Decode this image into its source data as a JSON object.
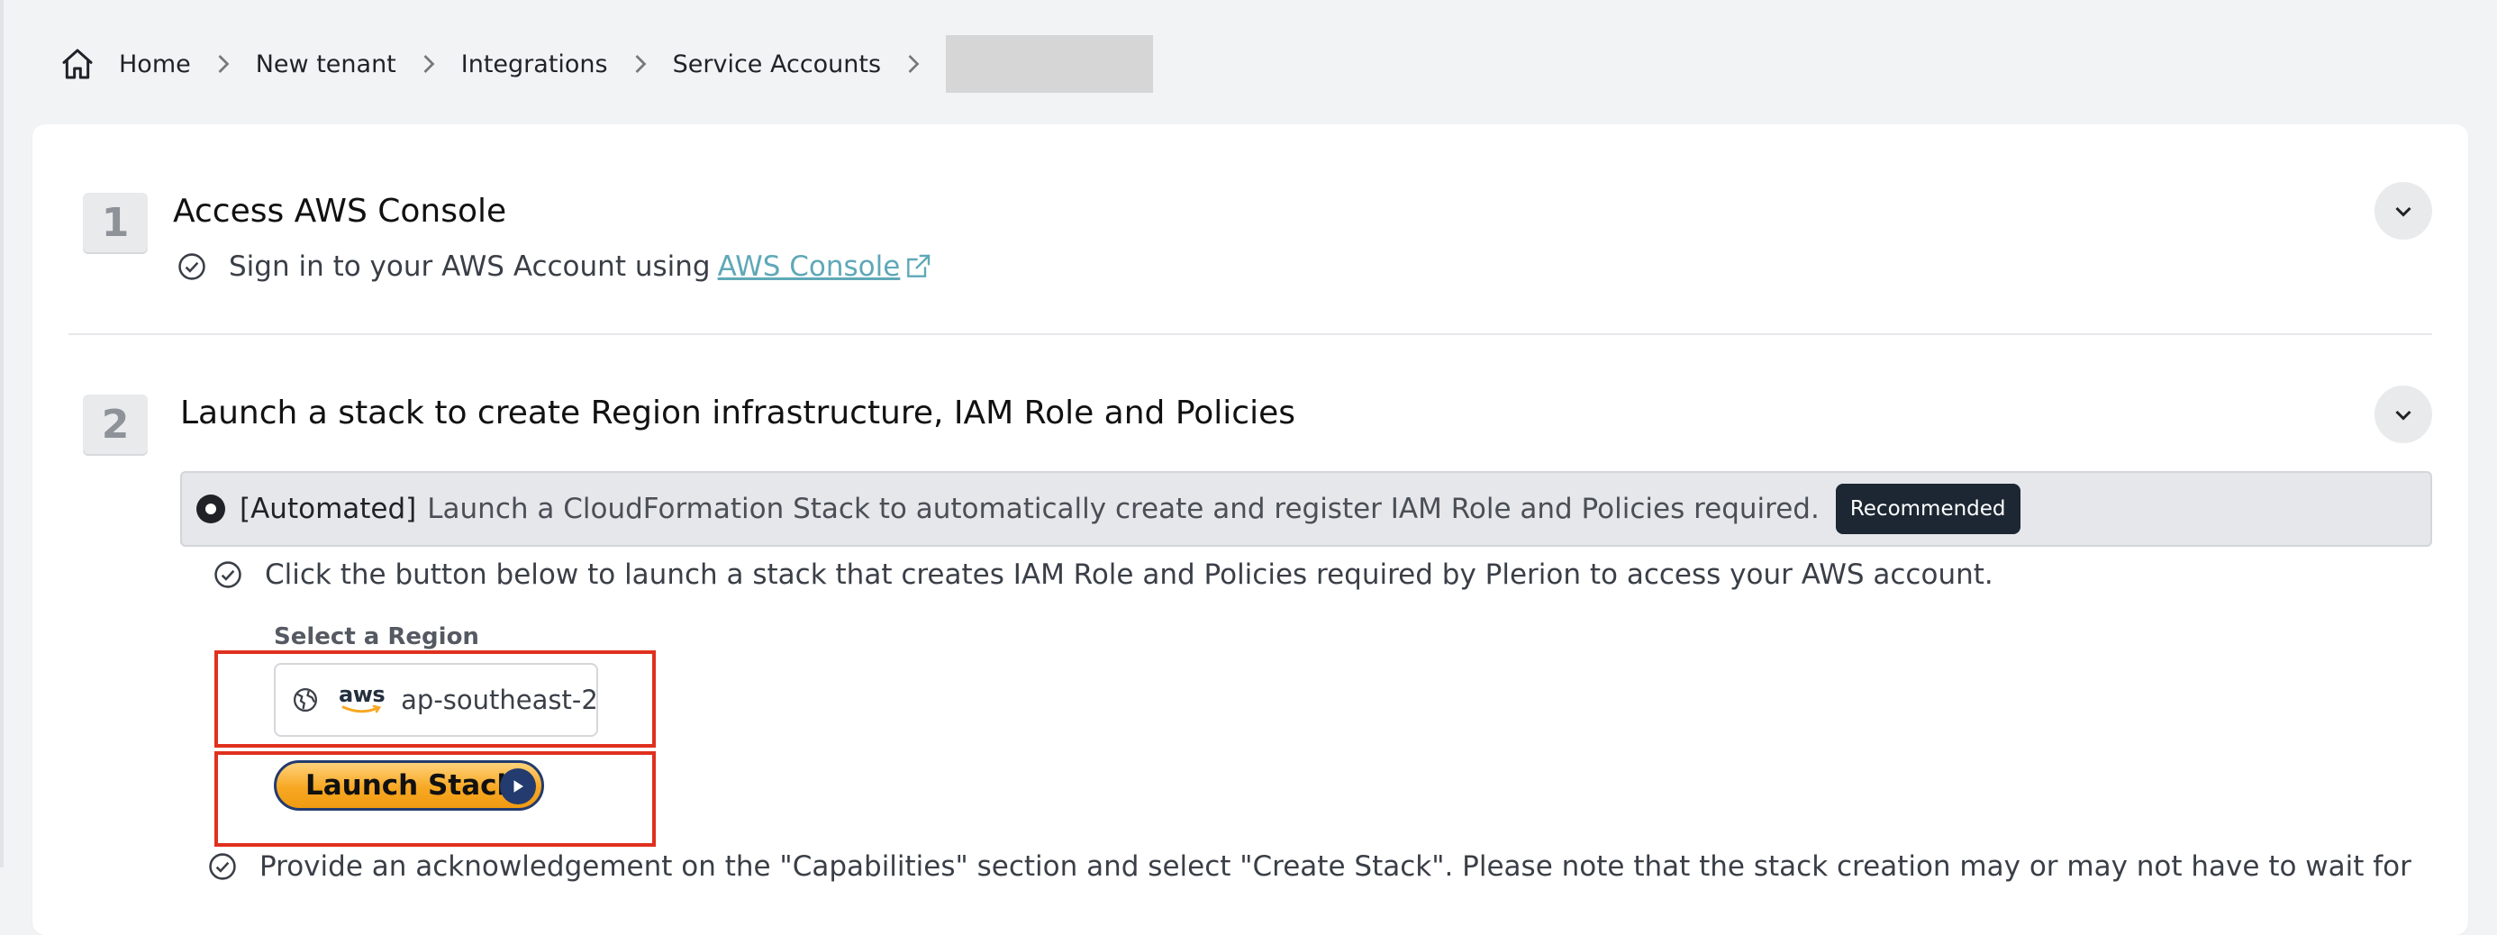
{
  "breadcrumb": {
    "items": [
      "Home",
      "New tenant",
      "Integrations",
      "Service Accounts"
    ]
  },
  "steps": [
    {
      "number": "1",
      "title": "Access AWS Console",
      "instruction_prefix": "Sign in to your AWS Account using",
      "link_text": "AWS Console"
    },
    {
      "number": "2",
      "title": "Launch a stack to create Region infrastructure, IAM Role and Policies",
      "option": {
        "tag": "[Automated]",
        "text": "Launch a CloudFormation Stack to automatically create and register IAM Role and Policies required.",
        "badge": "Recommended"
      },
      "instruction": "Click the button below to launch a stack that creates IAM Role and Policies required by Plerion to access your AWS account.",
      "region_label": "Select a Region",
      "region_value": "ap-southeast-2",
      "aws_logo_text": "aws",
      "launch_label": "Launch Stack",
      "next_instruction_partial": "Provide an acknowledgement on the \"Capabilities\" section and select \"Create Stack\". Please note that the stack creation may or may not have to wait for"
    }
  ],
  "colors": {
    "accent_link": "#5fa8b8",
    "badge_bg": "#1d2733",
    "highlight": "#e0301e",
    "launch_orange": "#f7a823",
    "launch_navy": "#233b6e"
  }
}
